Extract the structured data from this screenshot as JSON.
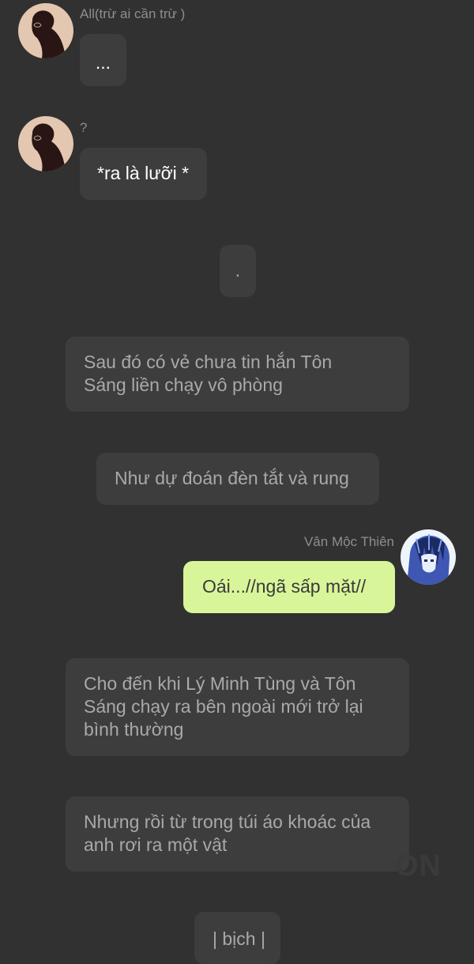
{
  "messages": [
    {
      "sender": "All(trừ ai cần trừ )",
      "text": "..."
    },
    {
      "sender": "?",
      "text": "*ra là lưỡi *"
    },
    {
      "text": "."
    },
    {
      "text": "Sau đó có vẻ chưa tin hắn Tôn\nSáng liền chạy vô phòng"
    },
    {
      "text": "Như dự đoán đèn tắt và rung"
    },
    {
      "sender": "Vân Mộc Thiên",
      "text": "Oái...//ngã sấp mặt//"
    },
    {
      "text": "Cho đến khi Lý Minh Tùng và Tôn\nSáng chạy ra bên ngoài mới trở lại\nbình thường"
    },
    {
      "text": "Nhưng rồi từ trong túi áo khoác của\nanh rơi ra một vật"
    },
    {
      "text": "| bịch |"
    }
  ],
  "watermark": "ON",
  "colors": {
    "background": "#313131",
    "bubble": "#3d3d3d",
    "own_bubble": "#d9f59a",
    "narration_text": "#a9a9a9",
    "sender_text": "#8e8e8e"
  },
  "icons": {
    "other_avatar": "silhouette-avatar-icon",
    "own_avatar": "anime-character-avatar-icon"
  }
}
